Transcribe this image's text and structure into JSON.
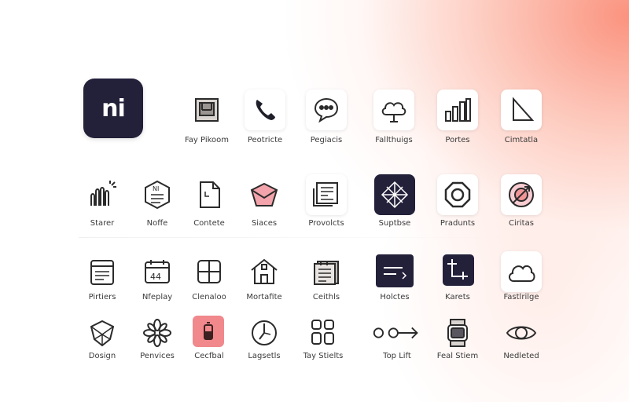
{
  "logo": {
    "text": "ni"
  },
  "colors": {
    "dark": "#23203a",
    "accent": "#f08a8a",
    "stroke": "#2b2b2b"
  },
  "rows": [
    [
      {
        "label": "Fay Pikoom",
        "icon": "box-icon"
      },
      {
        "label": "Peotricte",
        "icon": "phone-icon"
      },
      {
        "label": "Pegiacis",
        "icon": "chat-bubble-icon"
      },
      {
        "label": "Fallthuigs",
        "icon": "cloud-icon"
      },
      {
        "label": "Portes",
        "icon": "bar-chart-icon"
      },
      {
        "label": "Cimtatla",
        "icon": "play-triangle-icon"
      }
    ],
    [
      {
        "label": "Starer",
        "icon": "fan-icon"
      },
      {
        "label": "Noffe",
        "icon": "hexagon-badge-icon"
      },
      {
        "label": "Contete",
        "icon": "document-icon"
      },
      {
        "label": "Siaces",
        "icon": "envelope-icon"
      },
      {
        "label": "Provolcts",
        "icon": "newspaper-icon"
      },
      {
        "label": "Suptbse",
        "icon": "compass-icon"
      },
      {
        "label": "Pradunts",
        "icon": "octagon-ring-icon"
      },
      {
        "label": "Ciritas",
        "icon": "target-icon"
      }
    ],
    [
      {
        "label": "Pirtiers",
        "icon": "clipboard-icon"
      },
      {
        "label": "Nfeplay",
        "icon": "calendar-icon"
      },
      {
        "label": "Clenaloo",
        "icon": "grid-icon"
      },
      {
        "label": "Mortafite",
        "icon": "house-icon"
      },
      {
        "label": "Ceithls",
        "icon": "notes-icon"
      },
      {
        "label": "Holctes",
        "icon": "tag-icon"
      },
      {
        "label": "Karets",
        "icon": "crop-icon"
      },
      {
        "label": "Fastlrilge",
        "icon": "cloud-outline-icon"
      }
    ],
    [
      {
        "label": "Dosign",
        "icon": "shield-icon"
      },
      {
        "label": "Penvices",
        "icon": "flower-icon"
      },
      {
        "label": "Cecfbal",
        "icon": "battery-icon"
      },
      {
        "label": "Lagsetls",
        "icon": "clock-icon"
      },
      {
        "label": "Tay Stielts",
        "icon": "apps-icon"
      },
      {
        "label": "Top Lift",
        "icon": "arrow-path-icon"
      },
      {
        "label": "Feal Stiem",
        "icon": "watch-icon"
      },
      {
        "label": "Nedleted",
        "icon": "eye-icon"
      }
    ]
  ]
}
